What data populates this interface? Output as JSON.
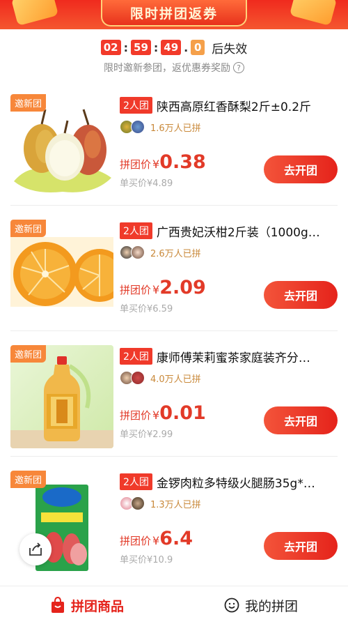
{
  "banner": {
    "title": "限时拼团返券"
  },
  "countdown": {
    "hours": "02",
    "minutes": "59",
    "seconds": "49",
    "tenths": "0",
    "suffix": "后失效"
  },
  "subtitle": {
    "text": "限时邀新参团，返优惠券奖励"
  },
  "products": [
    {
      "badge": "邀新团",
      "tag": "2人团",
      "title": "陕西高原红香酥梨2斤±0.2斤",
      "joined": "1.6万人已拼",
      "price_label": "拼团价",
      "currency": "¥",
      "price": "0.38",
      "single_price": "单买价¥4.89",
      "button": "去开团"
    },
    {
      "badge": "邀新团",
      "tag": "2人团",
      "title": "广西贵妃沃柑2斤装（1000g…",
      "joined": "2.6万人已拼",
      "price_label": "拼团价",
      "currency": "¥",
      "price": "2.09",
      "single_price": "单买价¥6.59",
      "button": "去开团"
    },
    {
      "badge": "邀新团",
      "tag": "2人团",
      "title": "康师傅茉莉蜜茶家庭装齐分…",
      "joined": "4.0万人已拼",
      "price_label": "拼团价",
      "currency": "¥",
      "price": "0.01",
      "single_price": "单买价¥2.99",
      "button": "去开团"
    },
    {
      "badge": "邀新团",
      "tag": "2人团",
      "title": "金锣肉粒多特级火腿肠35g*…",
      "joined": "1.3万人已拼",
      "price_label": "拼团价",
      "currency": "¥",
      "price": "6.4",
      "single_price": "单买价¥10.9",
      "button": "去开团"
    }
  ],
  "tabs": {
    "group_products": "拼团商品",
    "my_groups": "我的拼团"
  },
  "colors": {
    "accent": "#e5231b",
    "badge": "#f7873a",
    "joined": "#c9893a"
  }
}
